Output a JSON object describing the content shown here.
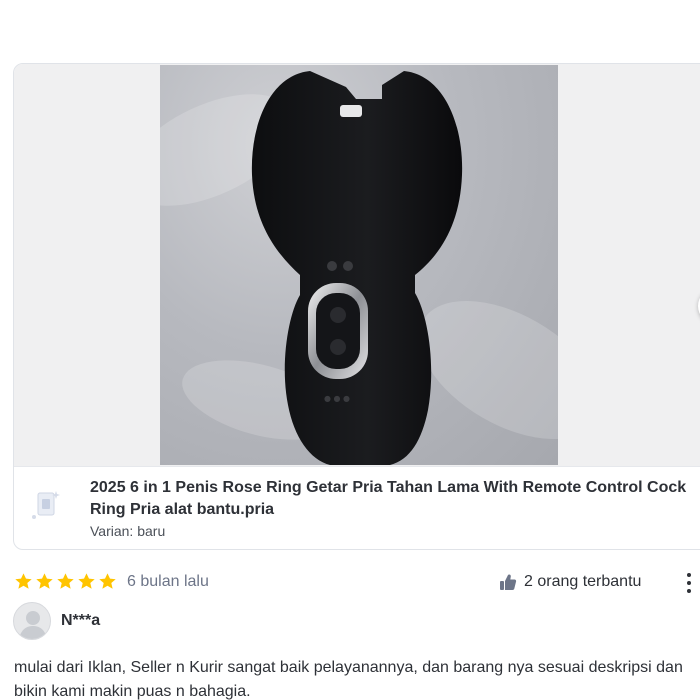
{
  "review": {
    "product": {
      "title": "2025 6 in 1 Penis Rose Ring Getar Pria Tahan Lama With Remote Control Cock Ring Pria alat bantu.pria",
      "variant": "Varian: baru"
    },
    "rating": 5,
    "time_ago": "6 bulan lalu",
    "helpful_text": "2 orang terbantu",
    "reviewer_name": "N***a",
    "text": "mulai dari Iklan, Seller n Kurir sangat baik pelayanannya, dan barang nya sesuai deskripsi dan bikin kami makin puas n bahagia."
  },
  "icons": {
    "star": "star-icon",
    "helpful": "thumbs-up-icon",
    "more": "more-vertical-icon",
    "next": "chevron-right-icon",
    "avatar": "user-avatar-icon",
    "product_thumb": "product-thumbnail-placeholder-icon"
  },
  "colors": {
    "star": "#FFC400",
    "text": "#2E3137",
    "muted": "#6D7588",
    "border": "#E0E3E8"
  }
}
